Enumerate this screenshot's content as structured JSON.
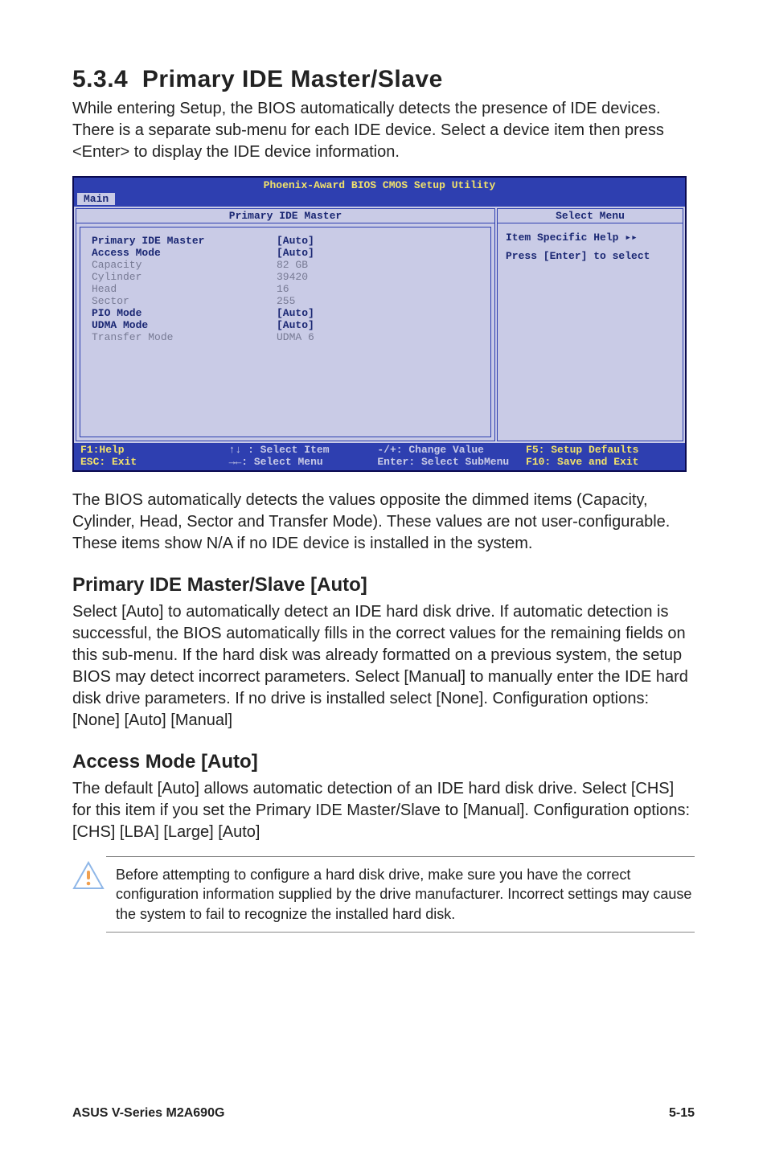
{
  "section": {
    "number": "5.3.4",
    "title": "Primary IDE Master/Slave"
  },
  "intro": "While entering Setup, the BIOS automatically detects the presence of IDE devices. There is a separate sub-menu for each IDE device. Select a device item then press <Enter> to display the IDE device information.",
  "bios": {
    "utility_title": "Phoenix-Award BIOS CMOS Setup Utility",
    "menubar_tab": "Main",
    "left_title": "Primary IDE Master",
    "rows": [
      {
        "label": "Primary IDE Master",
        "value": "[Auto]",
        "label_bold": true,
        "value_bold": true
      },
      {
        "label": "Access Mode",
        "value": "[Auto]",
        "label_bold": true,
        "value_bold": true
      },
      {
        "label": "",
        "value": "",
        "label_bold": false,
        "value_bold": false
      },
      {
        "label": "Capacity",
        "value": "82 GB",
        "label_bold": false,
        "value_bold": false
      },
      {
        "label": "",
        "value": "",
        "label_bold": false,
        "value_bold": false
      },
      {
        "label": "Cylinder",
        "value": "39420",
        "label_bold": false,
        "value_bold": false
      },
      {
        "label": "Head",
        "value": "16",
        "label_bold": false,
        "value_bold": false
      },
      {
        "label": "Sector",
        "value": "255",
        "label_bold": false,
        "value_bold": false
      },
      {
        "label": "PIO Mode",
        "value": "[Auto]",
        "label_bold": true,
        "value_bold": true
      },
      {
        "label": "UDMA Mode",
        "value": "[Auto]",
        "label_bold": true,
        "value_bold": true
      },
      {
        "label": "Transfer Mode",
        "value": "UDMA 6",
        "label_bold": false,
        "value_bold": false
      }
    ],
    "right_title": "Select Menu",
    "right_help_line1": "Item Specific Help ▸▸",
    "right_help_line2": "Press [Enter] to select",
    "footer": {
      "c1a": "F1:Help",
      "c1b": "ESC: Exit",
      "c2a": "↑↓ : Select Item",
      "c2b": "→←: Select Menu",
      "c3a": "-/+: Change Value",
      "c3b": "Enter: Select SubMenu",
      "c4a": "F5: Setup Defaults",
      "c4b": "F10: Save and Exit"
    }
  },
  "para_after_bios": "The BIOS automatically detects the values opposite the dimmed items (Capacity, Cylinder,  Head, Sector and Transfer Mode). These values are not user-configurable. These items show N/A if no IDE device is installed in the system.",
  "sub1": {
    "title": "Primary IDE Master/Slave [Auto]",
    "body": "Select [Auto] to automatically detect an IDE hard disk drive. If automatic detection is successful, the BIOS automatically fills in the correct values for the remaining fields on this sub-menu. If the hard disk was already formatted on a previous system, the setup BIOS may detect incorrect parameters. Select [Manual] to manually enter the IDE hard disk drive parameters. If no drive is installed select [None]. Configuration options: [None] [Auto] [Manual]"
  },
  "sub2": {
    "title": "Access Mode [Auto]",
    "body": "The default [Auto] allows automatic detection of an IDE hard disk drive. Select [CHS] for this item if you set the Primary IDE Master/Slave to [Manual]. Configuration options: [CHS] [LBA] [Large] [Auto]"
  },
  "note": "Before attempting to configure a hard disk drive, make sure you have the correct configuration information supplied by the drive manufacturer. Incorrect settings may cause the system to fail to recognize the installed hard disk.",
  "footer": {
    "left": "ASUS V-Series M2A690G",
    "right": "5-15"
  }
}
